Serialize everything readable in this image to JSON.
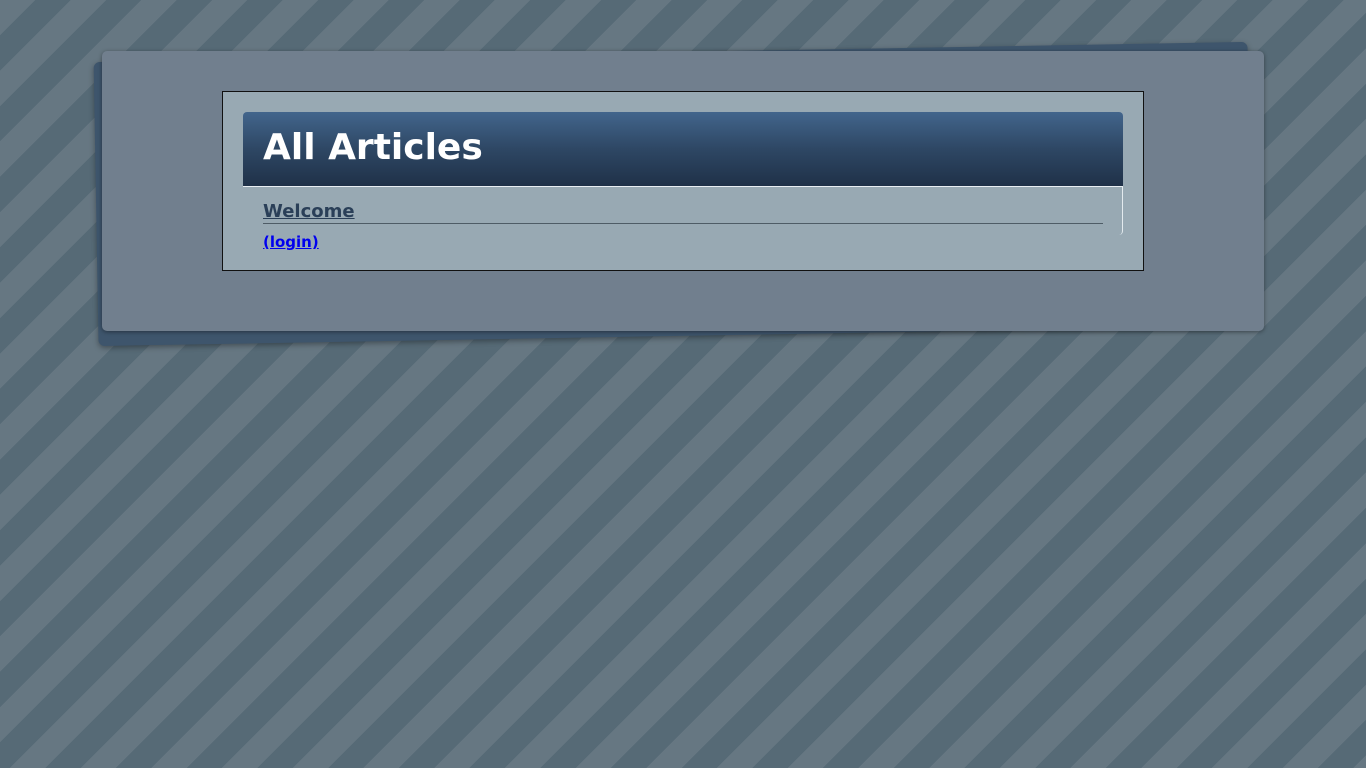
{
  "page": {
    "title": "All Articles"
  },
  "content": {
    "section_heading": "Welcome",
    "login_link": "(login)"
  },
  "colors": {
    "header_gradient_top": "#42658c",
    "header_gradient_bottom": "#1f3148",
    "link": "#0000ee",
    "heading_text": "#2a3f58",
    "panel_background": "#98a9b3",
    "card_background": "#717f8e"
  }
}
